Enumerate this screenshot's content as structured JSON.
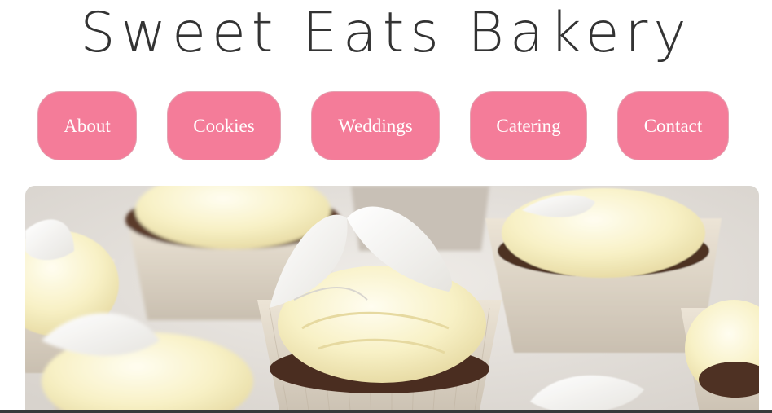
{
  "site": {
    "title": "Sweet Eats Bakery"
  },
  "nav": {
    "items": [
      {
        "label": "About"
      },
      {
        "label": "Cookies"
      },
      {
        "label": "Weddings"
      },
      {
        "label": "Catering"
      },
      {
        "label": "Contact"
      }
    ]
  },
  "hero": {
    "image": "cupcakes-with-buttercream-frosting-photo"
  },
  "colors": {
    "nav_button": "#f47c99",
    "title_text": "#333333",
    "background": "#ffffff"
  }
}
